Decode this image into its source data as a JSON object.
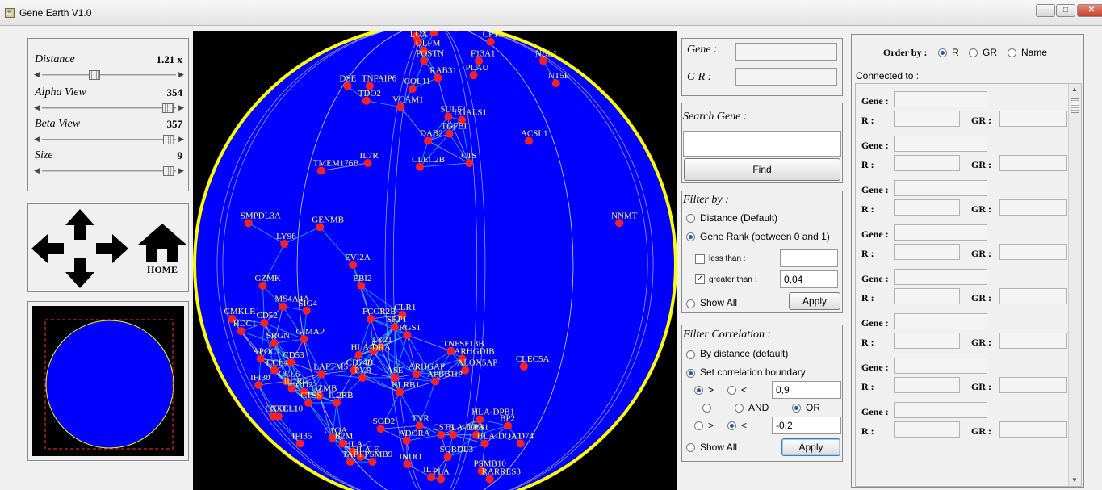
{
  "window": {
    "title": "Gene Earth V1.0"
  },
  "controls": {
    "distance": {
      "label": "Distance",
      "value": "1.21 x",
      "level": 0.38
    },
    "alpha": {
      "label": "Alpha View",
      "value": "354",
      "level": 0.98
    },
    "beta": {
      "label": "Beta View",
      "value": "357",
      "level": 0.99
    },
    "size": {
      "label": "Size",
      "value": "9",
      "level": 0.99
    }
  },
  "nav": {
    "home_label": "HOME"
  },
  "globe": {
    "colors": {
      "ocean": "#0000ff",
      "rim": "#ffff00",
      "node": "#ff2020",
      "label": "#ffff66",
      "link_light": "#22d7ee",
      "link_dark": "#c8c8c8"
    },
    "genes": [
      {
        "name": "CXCL12",
        "lon": -15,
        "lat": 72
      },
      {
        "name": "LOX",
        "lon": -11,
        "lat": 68
      },
      {
        "name": "POSTN",
        "lon": -5,
        "lat": 58
      },
      {
        "name": "OLFM",
        "lon": -6,
        "lat": 63
      },
      {
        "name": "ASP",
        "lon": -1,
        "lat": 75
      },
      {
        "name": "F13A1",
        "lon": 20,
        "lat": 58
      },
      {
        "name": "CPT2",
        "lon": 38,
        "lat": 68
      },
      {
        "name": "COL8A1",
        "lon": 30,
        "lat": 80
      },
      {
        "name": "NBL1",
        "lon": 58,
        "lat": 58
      },
      {
        "name": "NT5E",
        "lon": 50,
        "lat": 49
      },
      {
        "name": "DSE",
        "lon": -33,
        "lat": 48
      },
      {
        "name": "TNFAIP6",
        "lon": -24,
        "lat": 48
      },
      {
        "name": "TDO2",
        "lon": -23,
        "lat": 43
      },
      {
        "name": "RAB31",
        "lon": 1,
        "lat": 51
      },
      {
        "name": "PLAU",
        "lon": 15,
        "lat": 52
      },
      {
        "name": "COL11",
        "lon": -8,
        "lat": 47
      },
      {
        "name": "VCAM1",
        "lon": -11,
        "lat": 41
      },
      {
        "name": "SULF1",
        "lon": 4,
        "lat": 38
      },
      {
        "name": "LGALS1",
        "lon": 8,
        "lat": 37
      },
      {
        "name": "TGFBI",
        "lon": 4,
        "lat": 33
      },
      {
        "name": "DAB2",
        "lon": -2,
        "lat": 31
      },
      {
        "name": "ACSL1",
        "lon": 27,
        "lat": 31
      },
      {
        "name": "IL7R",
        "lon": -18,
        "lat": 25
      },
      {
        "name": "TMEM176B",
        "lon": -31,
        "lat": 23
      },
      {
        "name": "CLEC2B",
        "lon": -4,
        "lat": 24
      },
      {
        "name": "C1S",
        "lon": 9,
        "lat": 25
      },
      {
        "name": "SMPDL3A",
        "lon": -52,
        "lat": 10
      },
      {
        "name": "LY96",
        "lon": -39,
        "lat": 5
      },
      {
        "name": "GENMB",
        "lon": -29,
        "lat": 9
      },
      {
        "name": "NNMT",
        "lon": 51,
        "lat": 10
      },
      {
        "name": "EVI2A",
        "lon": -20,
        "lat": 0
      },
      {
        "name": "GZMK",
        "lon": -46,
        "lat": -5
      },
      {
        "name": "EBI2",
        "lon": -18,
        "lat": -5
      },
      {
        "name": "MS4A4A",
        "lon": -40,
        "lat": -10
      },
      {
        "name": "SIG4",
        "lon": -33,
        "lat": -11
      },
      {
        "name": "CMKLR1",
        "lon": -60,
        "lat": -13
      },
      {
        "name": "CD52",
        "lon": -47,
        "lat": -14
      },
      {
        "name": "FCGR2B",
        "lon": -16,
        "lat": -13
      },
      {
        "name": "CLR1",
        "lon": -8,
        "lat": -12
      },
      {
        "name": "SRP1",
        "lon": -10,
        "lat": -15
      },
      {
        "name": "RGS1",
        "lon": -7,
        "lat": -17
      },
      {
        "name": "HDC1",
        "lon": -57,
        "lat": -16
      },
      {
        "name": "SRGN",
        "lon": -45,
        "lat": -19
      },
      {
        "name": "GIMAP",
        "lon": -35,
        "lat": -18
      },
      {
        "name": "LY21",
        "lon": -14,
        "lat": -20
      },
      {
        "name": "LA",
        "lon": -16,
        "lat": -21
      },
      {
        "name": "HLA-DRA",
        "lon": -20,
        "lat": -22
      },
      {
        "name": "TNFSF13B",
        "lon": 4,
        "lat": -21
      },
      {
        "name": "ARHGDIB",
        "lon": 7,
        "lat": -23
      },
      {
        "name": "APOC1",
        "lon": -52,
        "lat": -23
      },
      {
        "name": "CD53",
        "lon": -41,
        "lat": -24
      },
      {
        "name": "CLEC5A",
        "lon": 24,
        "lat": -25
      },
      {
        "name": "CCL4",
        "lon": -48,
        "lat": -26
      },
      {
        "name": "CD74B",
        "lon": -22,
        "lat": -26
      },
      {
        "name": "ALOX5AP",
        "lon": 8,
        "lat": -26
      },
      {
        "name": "LAPTM5",
        "lon": -32,
        "lat": -27
      },
      {
        "name": "CCL5",
        "lon": -45,
        "lat": -29
      },
      {
        "name": "PYR",
        "lon": -20,
        "lat": -28
      },
      {
        "name": "ASE",
        "lon": -11,
        "lat": -28
      },
      {
        "name": "ARHGAP",
        "lon": -5,
        "lat": -27
      },
      {
        "name": "APBB1IP",
        "lon": 0,
        "lat": -29
      },
      {
        "name": "IFI30",
        "lon": -58,
        "lat": -30
      },
      {
        "name": "IL2RG",
        "lon": -44,
        "lat": -31
      },
      {
        "name": "KLRB1",
        "lon": -10,
        "lat": -32
      },
      {
        "name": "CD2",
        "lon": -40,
        "lat": -32
      },
      {
        "name": "GZMB",
        "lon": -35,
        "lat": -33
      },
      {
        "name": "CTSS",
        "lon": -40,
        "lat": -35
      },
      {
        "name": "IL2RB",
        "lon": -30,
        "lat": -35
      },
      {
        "name": "CXCL11",
        "lon": -60,
        "lat": -39
      },
      {
        "name": "CXCL10",
        "lon": -57,
        "lat": -39
      },
      {
        "name": "HLA-DPB1",
        "lon": 14,
        "lat": -40
      },
      {
        "name": "TYR",
        "lon": -5,
        "lat": -42
      },
      {
        "name": "BP2",
        "lon": 24,
        "lat": -42
      },
      {
        "name": "SOD2",
        "lon": -18,
        "lat": -43
      },
      {
        "name": "CSTA",
        "lon": 2,
        "lat": -45
      },
      {
        "name": "HLA-DRB",
        "lon": 6,
        "lat": -45
      },
      {
        "name": "LPA1",
        "lon": 14,
        "lat": -45
      },
      {
        "name": "ADORA",
        "lon": -10,
        "lat": -47
      },
      {
        "name": "IFI35",
        "lon": -57,
        "lat": -48
      },
      {
        "name": "C1QA",
        "lon": -38,
        "lat": -46
      },
      {
        "name": "CD74",
        "lon": 32,
        "lat": -48
      },
      {
        "name": "HLA-DQA1",
        "lon": 18,
        "lat": -48
      },
      {
        "name": "B2M",
        "lon": -35,
        "lat": -48
      },
      {
        "name": "HLA-C",
        "lon": -33,
        "lat": -51
      },
      {
        "name": "HLA-E",
        "lon": -31,
        "lat": -53
      },
      {
        "name": "SQRDL3",
        "lon": 5,
        "lat": -53
      },
      {
        "name": "PSMB9",
        "lon": -27,
        "lat": -55
      },
      {
        "name": "TAP1",
        "lon": -38,
        "lat": -55
      },
      {
        "name": "INDO",
        "lon": -12,
        "lat": -56
      },
      {
        "name": "IL1",
        "lon": -2,
        "lat": -62
      },
      {
        "name": "PSMB10",
        "lon": 22,
        "lat": -59
      },
      {
        "name": "RARRES3",
        "lon": 30,
        "lat": -63
      },
      {
        "name": "PLA",
        "lon": 3,
        "lat": -63
      }
    ]
  },
  "gene_info": {
    "gene_label": "Gene :",
    "gene_value": "",
    "gr_label": "G R :",
    "gr_value": ""
  },
  "search": {
    "label": "Search Gene :",
    "value": "",
    "find_label": "Find"
  },
  "filter_by": {
    "title": "Filter by :",
    "distance_label": "Distance (Default)",
    "rank_label": "Gene Rank (between 0 and 1)",
    "less_label": "less than :",
    "less_value": "",
    "greater_label": "greater than :",
    "greater_value": "0,04",
    "show_all_label": "Show All",
    "apply_label": "Apply"
  },
  "filter_corr": {
    "title": "Filter Correlation :",
    "by_distance_label": "By distance (default)",
    "boundary_label": "Set correlation boundary",
    "gt_symbol": ">",
    "lt_symbol": "<",
    "upper_value": "0,9",
    "and_label": "AND",
    "or_label": "OR",
    "lower_value": "-0,2",
    "show_all_label": "Show All",
    "apply_label": "Apply"
  },
  "order_by": {
    "label": "Order by :",
    "r_label": "R",
    "gr_label": "GR",
    "name_label": "Name",
    "connected_label": "Connected to :"
  },
  "connected": {
    "gene_label": "Gene :",
    "r_label": "R :",
    "gr_label": "GR :",
    "rows": [
      {
        "gene": "",
        "r": "",
        "gr": ""
      },
      {
        "gene": "",
        "r": "",
        "gr": ""
      },
      {
        "gene": "",
        "r": "",
        "gr": ""
      },
      {
        "gene": "",
        "r": "",
        "gr": ""
      },
      {
        "gene": "",
        "r": "",
        "gr": ""
      },
      {
        "gene": "",
        "r": "",
        "gr": ""
      },
      {
        "gene": "",
        "r": "",
        "gr": ""
      },
      {
        "gene": "",
        "r": "",
        "gr": ""
      }
    ]
  }
}
